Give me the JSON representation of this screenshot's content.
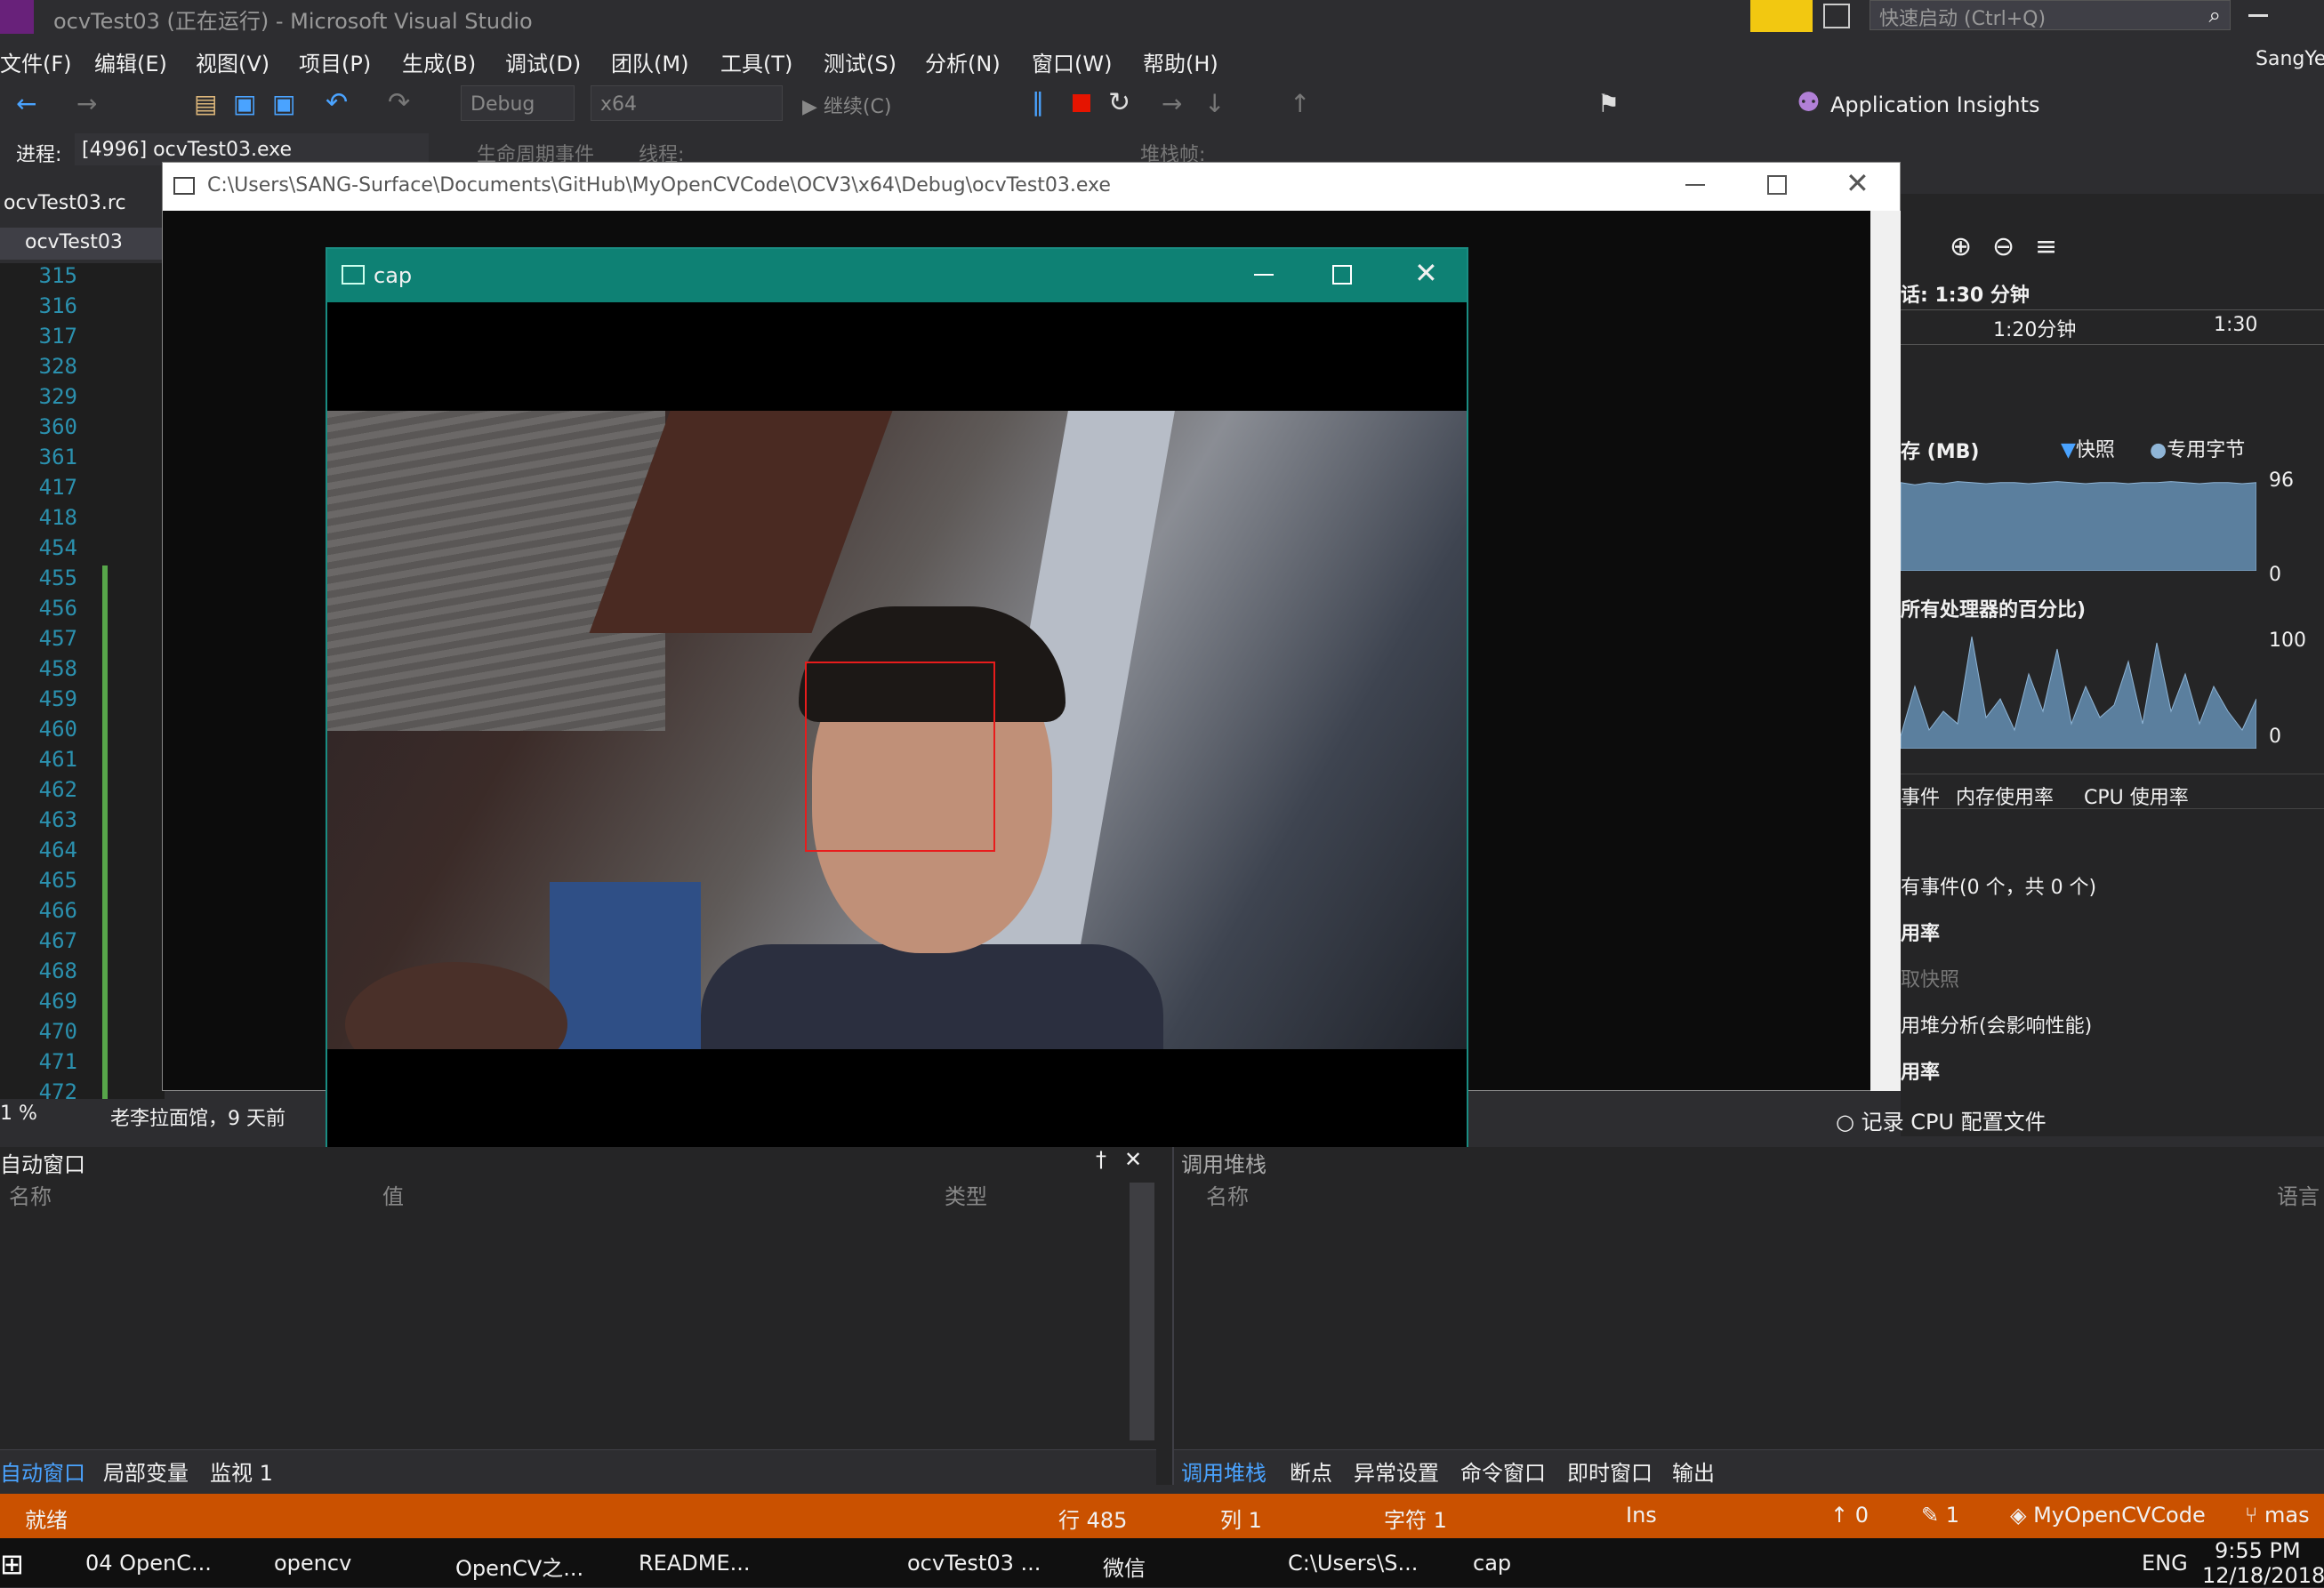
{
  "app": {
    "title": "ocvTest03 (正在运行) - Microsoft Visual Studio",
    "quick_launch": "快速启动 (Ctrl+Q)",
    "user": "SangYe"
  },
  "menu": [
    "文件(F)",
    "编辑(E)",
    "视图(V)",
    "项目(P)",
    "生成(B)",
    "调试(D)",
    "团队(M)",
    "工具(T)",
    "测试(S)",
    "分析(N)",
    "窗口(W)",
    "帮助(H)"
  ],
  "toolbar": {
    "config": "Debug",
    "platform": "x64",
    "continue": "继续(C)",
    "insights": "Application Insights"
  },
  "process": {
    "label": "进程:",
    "value": "[4996] ocvTest03.exe",
    "lifecycle": "生命周期事件",
    "thread": "线程:",
    "stack": "堆栈帧:"
  },
  "editor": {
    "tab1": "ocvTest03.rc",
    "tab2": "ocvTest03",
    "lines": [
      "315",
      "316",
      "317",
      "328",
      "329",
      "360",
      "361",
      "417",
      "418",
      "454",
      "455",
      "456",
      "457",
      "458",
      "459",
      "460",
      "461",
      "462",
      "463",
      "464",
      "465",
      "466",
      "467",
      "468",
      "469",
      "470",
      "471",
      "472"
    ],
    "zoom": "1 %",
    "nav": "老李拉面馆，9 天前"
  },
  "console": {
    "title": "C:\\Users\\SANG-Surface\\Documents\\GitHub\\MyOpenCVCode\\OCV3\\x64\\Debug\\ocvTest03.exe"
  },
  "cap": {
    "title": "cap"
  },
  "diag": {
    "session": "话: 1:30 分钟",
    "tick1": "1:20分钟",
    "tick2": "1:30",
    "mem_title": "存 (MB)",
    "legend_snapshot": "快照",
    "legend_private": "专用字节",
    "mem_max": "96",
    "mem_min": "0",
    "cpu_title": "所有处理器的百分比)",
    "cpu_max": "100",
    "cpu_min": "0",
    "tabs": [
      "事件",
      "内存使用率",
      "CPU 使用率"
    ],
    "events": "有事件(0 个，共 0 个)",
    "sec1": "用率",
    "snapshot": "取快照",
    "heap": "用堆分析(会影响性能)",
    "sec2": "用率",
    "record": "记录 CPU 配置文件",
    "mem_values": [
      0.8,
      0.78,
      0.8,
      0.79,
      0.81,
      0.8,
      0.79,
      0.8,
      0.8,
      0.79,
      0.8,
      0.81,
      0.8,
      0.79,
      0.8,
      0.8,
      0.79,
      0.8,
      0.8,
      0.81,
      0.8,
      0.79,
      0.8,
      0.8,
      0.79,
      0.8
    ],
    "cpu_values": [
      0.1,
      0.5,
      0.15,
      0.3,
      0.2,
      0.9,
      0.25,
      0.4,
      0.15,
      0.6,
      0.3,
      0.8,
      0.2,
      0.5,
      0.25,
      0.35,
      0.7,
      0.2,
      0.85,
      0.3,
      0.6,
      0.2,
      0.5,
      0.3,
      0.15,
      0.4
    ]
  },
  "auto": {
    "title": "自动窗口",
    "col_name": "名称",
    "col_value": "值",
    "col_type": "类型",
    "tabs": [
      "自动窗口",
      "局部变量",
      "监视 1"
    ]
  },
  "callstack": {
    "title": "调用堆栈",
    "col_name": "名称",
    "col_lang": "语言",
    "tabs": [
      "调用堆栈",
      "断点",
      "异常设置",
      "命令窗口",
      "即时窗口",
      "输出"
    ]
  },
  "status": {
    "ready": "就绪",
    "row": "行 485",
    "col": "列 1",
    "char": "字符 1",
    "ins": "Ins",
    "up": "0",
    "edit": "1",
    "repo": "MyOpenCVCode",
    "branch": "mas"
  },
  "taskbar": {
    "items": [
      "04 OpenC...",
      "opencv",
      "OpenCV之...",
      "README...",
      "ocvTest03 ...",
      "微信",
      "C:\\Users\\S...",
      "cap"
    ],
    "lang": "ENG",
    "time": "9:55 PM",
    "date": "12/18/2018"
  }
}
